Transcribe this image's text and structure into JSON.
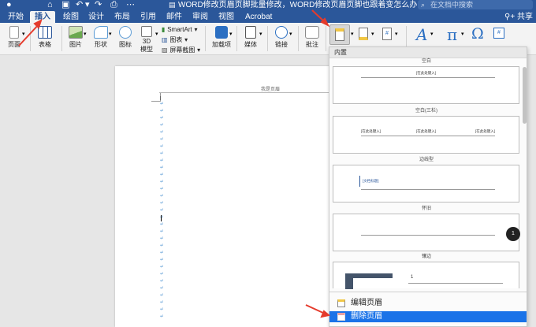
{
  "titlebar": {
    "title": "WORD修改页眉页脚批量修改，WORD修改页眉页脚也跟着变怎么办",
    "search_placeholder": "在文档中搜索"
  },
  "tabs": [
    "开始",
    "插入",
    "绘图",
    "设计",
    "布局",
    "引用",
    "邮件",
    "审阅",
    "视图",
    "Acrobat"
  ],
  "active_tab": "插入",
  "share_label": "共享",
  "ribbon": {
    "page": "页面",
    "table": "表格",
    "picture": "图片",
    "shapes": "形状",
    "icons": "图标",
    "model3d_1": "3D",
    "model3d_2": "模型",
    "smartart": "SmartArt",
    "chart": "图表",
    "screenshot": "屏幕截图",
    "addins": "加载项",
    "media": "媒体",
    "link": "链接",
    "comment": "批注"
  },
  "document": {
    "header_text": "我是页眉",
    "para_mark": "↵"
  },
  "gallery": {
    "section": "内置",
    "items": [
      {
        "title": "空白",
        "placeholders": [
          "[在此处键入]"
        ]
      },
      {
        "title": "空白(三栏)",
        "placeholders": [
          "[在此处键入]",
          "[在此处键入]",
          "[在此处键入]"
        ]
      },
      {
        "title": "边线型",
        "placeholders": [
          "[文档标题]"
        ]
      },
      {
        "title": "怀旧",
        "placeholders": [
          "1"
        ]
      },
      {
        "title": "镶边",
        "placeholders": [
          "1"
        ]
      }
    ],
    "menu": {
      "edit": "编辑页眉",
      "delete": "删除页眉"
    }
  },
  "colors": {
    "brand": "#2b579a",
    "selection": "#1a73e8",
    "annotation_arrow": "#e53b2c"
  }
}
